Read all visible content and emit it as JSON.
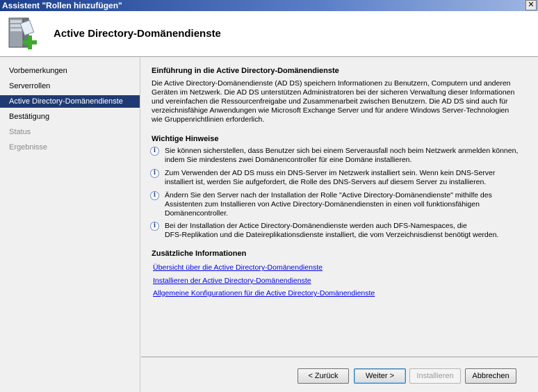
{
  "window": {
    "title": "Assistent \"Rollen hinzufügen\"",
    "close_glyph": "✕"
  },
  "header": {
    "title": "Active Directory-Domänendienste",
    "icon": "server-add-icon"
  },
  "nav": {
    "items": [
      {
        "label": "Vorbemerkungen",
        "state": "normal"
      },
      {
        "label": "Serverrollen",
        "state": "normal"
      },
      {
        "label": "Active Directory-Domänendienste",
        "state": "active"
      },
      {
        "label": "Bestätigung",
        "state": "normal"
      },
      {
        "label": "Status",
        "state": "disabled"
      },
      {
        "label": "Ergebnisse",
        "state": "disabled"
      }
    ]
  },
  "content": {
    "intro_title": "Einführung in die Active Directory-Domänendienste",
    "intro_lines": [
      "Die Active Directory-Domänendienste (AD DS) speichern Informationen zu Benutzern, Computern und anderen",
      "Geräten im Netzwerk. Die AD DS unterstützen Administratoren bei der sicheren Verwaltung dieser Informationen",
      "und vereinfachen die Ressourcenfreigabe und Zusammenarbeit zwischen Benutzern. Die AD DS sind auch für",
      "verzeichnisfähige Anwendungen wie Microsoft Exchange Server und für andere Windows Server-Technologien",
      "wie Gruppenrichtlinien erforderlich."
    ],
    "hints_title": "Wichtige Hinweise",
    "hints": [
      {
        "lines": [
          "Sie können sicherstellen, dass Benutzer sich bei einem Serverausfall noch beim Netzwerk anmelden können,",
          "indem Sie mindestens zwei Domänencontroller für eine Domäne installieren."
        ]
      },
      {
        "lines": [
          "Zum Verwenden der AD DS muss ein DNS-Server im Netzwerk installiert sein. Wenn kein DNS-Server",
          "installiert ist, werden Sie aufgefordert, die Rolle des DNS-Servers auf diesem Server zu installieren."
        ]
      },
      {
        "lines": [
          "Ändern Sie den Server nach der Installation der Rolle \"Active Directory-Domänendienste\" mithilfe des",
          "Assistenten zum Installieren von Active Directory-Domänendiensten in einen voll funktionsfähigen",
          "Domänencontroller."
        ]
      },
      {
        "lines": [
          "Bei der Installation der Actice Directory-Domänendienste werden auch DFS-Namespaces, die",
          "DFS-Replikation und die Dateireplikationsdienste installiert, die vom Verzeichnisdienst benötigt werden."
        ]
      }
    ],
    "info_title": "Zusätzliche Informationen",
    "links": [
      "Übersicht über die Active Directory-Domänendienste",
      "Installieren der Active Directory-Domänendienste",
      "Allgemeine Konfigurationen für die Active Directory-Domänendienste"
    ]
  },
  "buttons": {
    "back": "< Zurück",
    "next": "Weiter >",
    "install": "Installieren",
    "cancel": "Abbrechen"
  }
}
